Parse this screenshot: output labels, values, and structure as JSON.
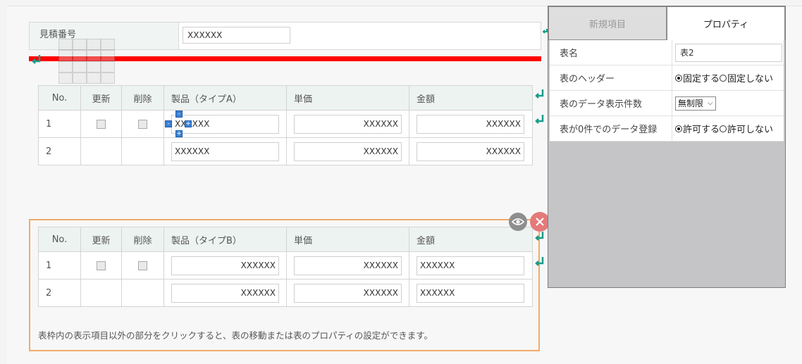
{
  "header_field": {
    "label": "見積番号",
    "value": "XXXXXX"
  },
  "table_a": {
    "headers": [
      "No.",
      "更新",
      "削除",
      "製品（タイプA）",
      "単価",
      "金額"
    ],
    "rows": [
      {
        "no": "1",
        "product": "XXXXXX",
        "price": "XXXXXX",
        "amount": "XXXXXX"
      },
      {
        "no": "2",
        "product": "XXXXXX",
        "price": "XXXXXX",
        "amount": "XXXXXX"
      }
    ]
  },
  "table_b": {
    "headers": [
      "No.",
      "更新",
      "削除",
      "製品（タイプB）",
      "単価",
      "金額"
    ],
    "rows": [
      {
        "no": "1",
        "product": "XXXXXX",
        "price": "XXXXXX",
        "amount": "XXXXXX"
      },
      {
        "no": "2",
        "product": "XXXXXX",
        "price": "XXXXXX",
        "amount": "XXXXXX"
      }
    ]
  },
  "hint_text": "表枠内の表示項目以外の部分をクリックすると、表の移動または表のプロパティの設定ができます。",
  "panel": {
    "tab_new": "新規項目",
    "tab_props": "プロパティ",
    "props": {
      "table_name_label": "表名",
      "table_name_value": "表2",
      "header_label": "表のヘッダー",
      "header_opt1": "固定する",
      "header_opt2": "固定しない",
      "count_label": "表のデータ表示件数",
      "count_value": "無制限",
      "zero_label": "表が0件でのデータ登録",
      "zero_opt1": "許可する",
      "zero_opt2": "許可しない"
    }
  },
  "colors": {
    "accent_teal": "#1a9d8a",
    "drop_line_red": "#ff0000",
    "selection_orange": "#f0ab6c",
    "close_red": "#e47a7a"
  },
  "icons": [
    "return-arrow-icon",
    "eye-icon",
    "close-icon",
    "minus-icon",
    "plus-icon"
  ]
}
